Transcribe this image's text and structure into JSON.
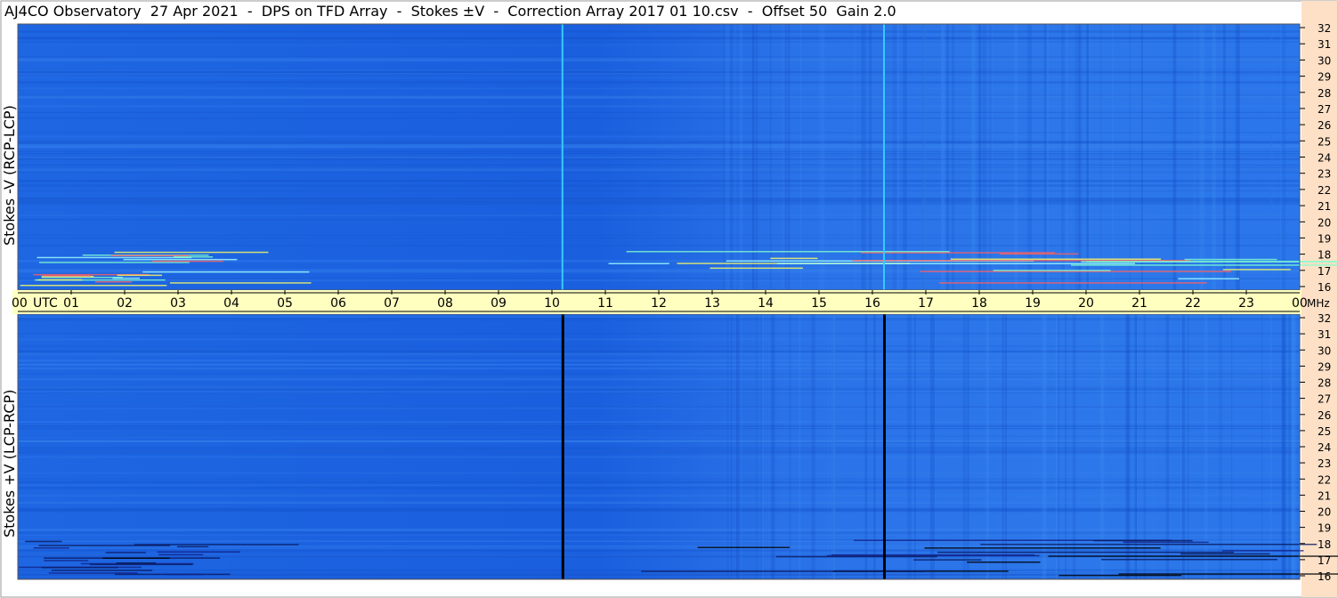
{
  "window": {
    "title": "AJ4CO Observatory  27 Apr 2021  -  DPS on TFD Array  -  Stokes ±V  -  Correction Array 2017 01 10.csv  -  Offset 50  Gain 2.0"
  },
  "colors": {
    "background": "#1f6ee8",
    "time_axis_band": "#ffffc0",
    "freq_axis_band": "#fde0c6",
    "border": "#000000"
  },
  "chart_data": [
    {
      "type": "heatmap",
      "panel": "top",
      "ylabel": "Stokes -V (RCP-LCP)",
      "x": {
        "unit": "UTC",
        "min": 0,
        "max": 24
      },
      "y": {
        "unit": "MHz",
        "min": 16,
        "max": 32
      },
      "y_ticks": [
        "32",
        "31",
        "30",
        "29",
        "28",
        "27",
        "26",
        "25",
        "24",
        "23",
        "22",
        "21",
        "20",
        "19",
        "18",
        "17",
        "16"
      ],
      "vertical_lines_utc": [
        10.18,
        16.2
      ],
      "vertical_line_color": "#33ccff"
    },
    {
      "type": "heatmap",
      "panel": "bottom",
      "ylabel": "Stokes +V (LCP-RCP)",
      "x": {
        "unit": "UTC",
        "min": 0,
        "max": 24
      },
      "y": {
        "unit": "MHz",
        "min": 16,
        "max": 32
      },
      "y_ticks": [
        "32",
        "31",
        "30",
        "29",
        "28",
        "27",
        "26",
        "25",
        "24",
        "23",
        "22",
        "21",
        "20",
        "19",
        "18",
        "17",
        "16"
      ],
      "vertical_lines_utc": [
        10.18,
        16.2
      ],
      "vertical_line_color": "#000000"
    }
  ],
  "time_axis": {
    "start_label": "00",
    "unit_label": "UTC",
    "labels": [
      "01",
      "02",
      "03",
      "04",
      "05",
      "06",
      "07",
      "08",
      "09",
      "10",
      "11",
      "12",
      "13",
      "14",
      "15",
      "16",
      "17",
      "18",
      "19",
      "20",
      "21",
      "22",
      "23"
    ],
    "end_label": "00",
    "end_unit_label": "MHz"
  }
}
